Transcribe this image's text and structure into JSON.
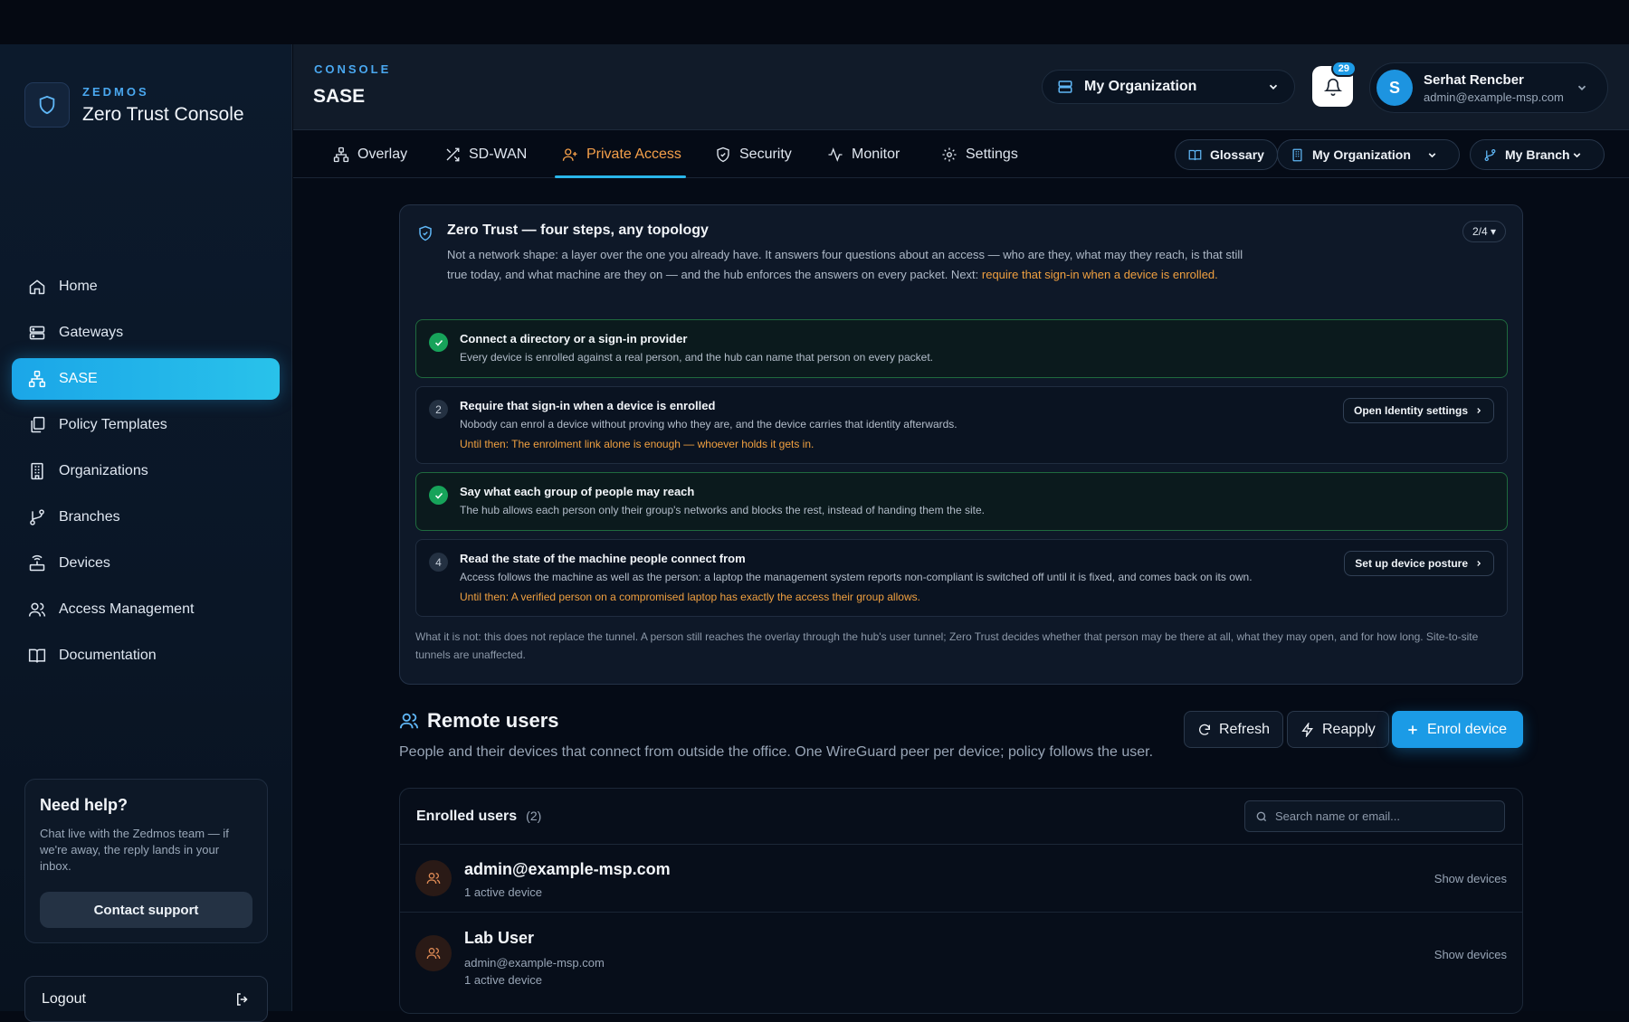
{
  "brand": {
    "small": "ZEDMOS",
    "title": "Zero Trust Console"
  },
  "sidebar": {
    "items": [
      {
        "label": "Home",
        "icon": "home-icon"
      },
      {
        "label": "Gateways",
        "icon": "server-icon"
      },
      {
        "label": "SASE",
        "icon": "network-icon",
        "active": true
      },
      {
        "label": "Policy Templates",
        "icon": "copy-icon"
      },
      {
        "label": "Organizations",
        "icon": "building-icon"
      },
      {
        "label": "Branches",
        "icon": "git-branch-icon"
      },
      {
        "label": "Devices",
        "icon": "router-icon"
      },
      {
        "label": "Access Management",
        "icon": "users-icon"
      },
      {
        "label": "Documentation",
        "icon": "book-icon"
      }
    ],
    "help": {
      "title": "Need help?",
      "text": "Chat live with the Zedmos team — if we're away, the reply lands in your inbox.",
      "button": "Contact support"
    },
    "logout": "Logout"
  },
  "header": {
    "crumb": "CONSOLE",
    "title": "SASE",
    "org_selector": "My Organization",
    "notifications": "29",
    "user": {
      "initial": "S",
      "name": "Serhat Rencber",
      "email": "admin@example-msp.com"
    }
  },
  "tabs": [
    {
      "label": "Overlay",
      "icon": "network-icon"
    },
    {
      "label": "SD-WAN",
      "icon": "shuffle-icon"
    },
    {
      "label": "Private Access",
      "icon": "user-plus-icon",
      "active": true
    },
    {
      "label": "Security",
      "icon": "shield-icon"
    },
    {
      "label": "Monitor",
      "icon": "activity-icon"
    },
    {
      "label": "Settings",
      "icon": "gear-icon"
    }
  ],
  "pills": {
    "glossary": "Glossary",
    "organization": "My Organization",
    "branch": "My Branch"
  },
  "zero_trust": {
    "title": "Zero Trust — four steps, any topology",
    "step_indicator": "2/4 ▾",
    "desc_a": "Not a network shape: a layer over the one you already have. It answers four questions about an access — who are they, what may they reach, is that still true today, and what machine are they on — and the hub enforces the answers on every packet. Next: ",
    "desc_link": "require that sign-in when a device is enrolled",
    "desc_end": ".",
    "steps": [
      {
        "mark": "✓",
        "done": true,
        "title": "Connect a directory or a sign-in provider",
        "text": "Every device is enrolled against a real person, and the hub can name that person on every packet."
      },
      {
        "mark": "2",
        "done": false,
        "title": "Require that sign-in when a device is enrolled",
        "text": "Nobody can enrol a device without proving who they are, and the device carries that identity afterwards.",
        "warn": "Until then: The enrolment link alone is enough — whoever holds it gets in.",
        "button": "Open Identity settings"
      },
      {
        "mark": "✓",
        "done": true,
        "title": "Say what each group of people may reach",
        "text": "The hub allows each person only their group's networks and blocks the rest, instead of handing them the site."
      },
      {
        "mark": "4",
        "done": false,
        "title": "Read the state of the machine people connect from",
        "text": "Access follows the machine as well as the person: a laptop the management system reports non-compliant is switched off until it is fixed, and comes back on its own.",
        "warn": "Until then: A verified person on a compromised laptop has exactly the access their group allows.",
        "button": "Set up device posture"
      }
    ],
    "footer": "What it is not: this does not replace the tunnel. A person still reaches the overlay through the hub's user tunnel; Zero Trust decides whether that person may be there at all, what they may open, and for how long. Site-to-site tunnels are unaffected."
  },
  "remote_users": {
    "title": "Remote users",
    "desc": "People and their devices that connect from outside the office. One WireGuard peer per device; policy follows the user.",
    "refresh": "Refresh",
    "reapply": "Reapply",
    "enrol": "Enrol device",
    "list_title": "Enrolled users",
    "count": "(2)",
    "search_placeholder": "Search name or email...",
    "users": [
      {
        "name": "admin@example-msp.com",
        "email": "",
        "devices": "1 active device",
        "action": "Show devices"
      },
      {
        "name": "Lab User",
        "email": "admin@example-msp.com",
        "devices": "1 active device",
        "action": "Show devices"
      }
    ]
  },
  "colors": {
    "accent": "#1b9be6",
    "active_tab": "#f5a04a",
    "success": "#17a35a",
    "warning": "#f0a040"
  }
}
